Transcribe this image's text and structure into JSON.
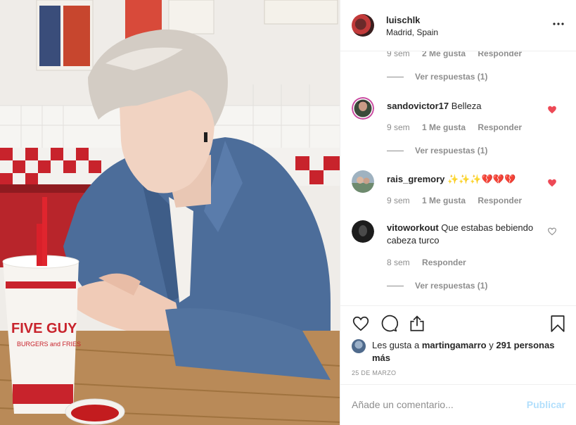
{
  "post": {
    "username": "luischlk",
    "location": "Madrid, Spain",
    "photo_cup_text": "FIVE GUY",
    "photo_cup_subtext": "BURGERS and FRIES"
  },
  "comments": [
    {
      "meta": {
        "time": "9 sem",
        "likes": "2 Me gusta",
        "reply": "Responder"
      },
      "view_replies": "Ver respuestas (1)"
    },
    {
      "username": "sandovictor17",
      "text": "Belleza",
      "meta": {
        "time": "9 sem",
        "likes": "1 Me gusta",
        "reply": "Responder"
      },
      "liked": true,
      "view_replies": "Ver respuestas (1)"
    },
    {
      "username": "rais_gremory",
      "text": "✨✨✨💔💔💔",
      "meta": {
        "time": "9 sem",
        "likes": "1 Me gusta",
        "reply": "Responder"
      },
      "liked": true
    },
    {
      "username": "vitoworkout",
      "text": "Que estabas bebiendo cabeza turco",
      "meta": {
        "time": "8 sem",
        "reply": "Responder"
      },
      "liked": false,
      "view_replies": "Ver respuestas (1)"
    }
  ],
  "actions": {
    "icons": [
      "heart-icon",
      "comment-icon",
      "share-icon",
      "bookmark-icon"
    ],
    "likes_prefix": "Les gusta a",
    "likes_user": "martingamarro",
    "likes_conjunction": "y",
    "likes_count": "291 personas más",
    "date": "25 DE MARZO"
  },
  "add_comment": {
    "placeholder": "Añade un comentario...",
    "publish_label": "Publicar"
  },
  "colors": {
    "like_red": "#ed4956",
    "muted_text": "#8e8e8e",
    "publish_disabled": "#b2dffc",
    "divider": "#efefef"
  }
}
